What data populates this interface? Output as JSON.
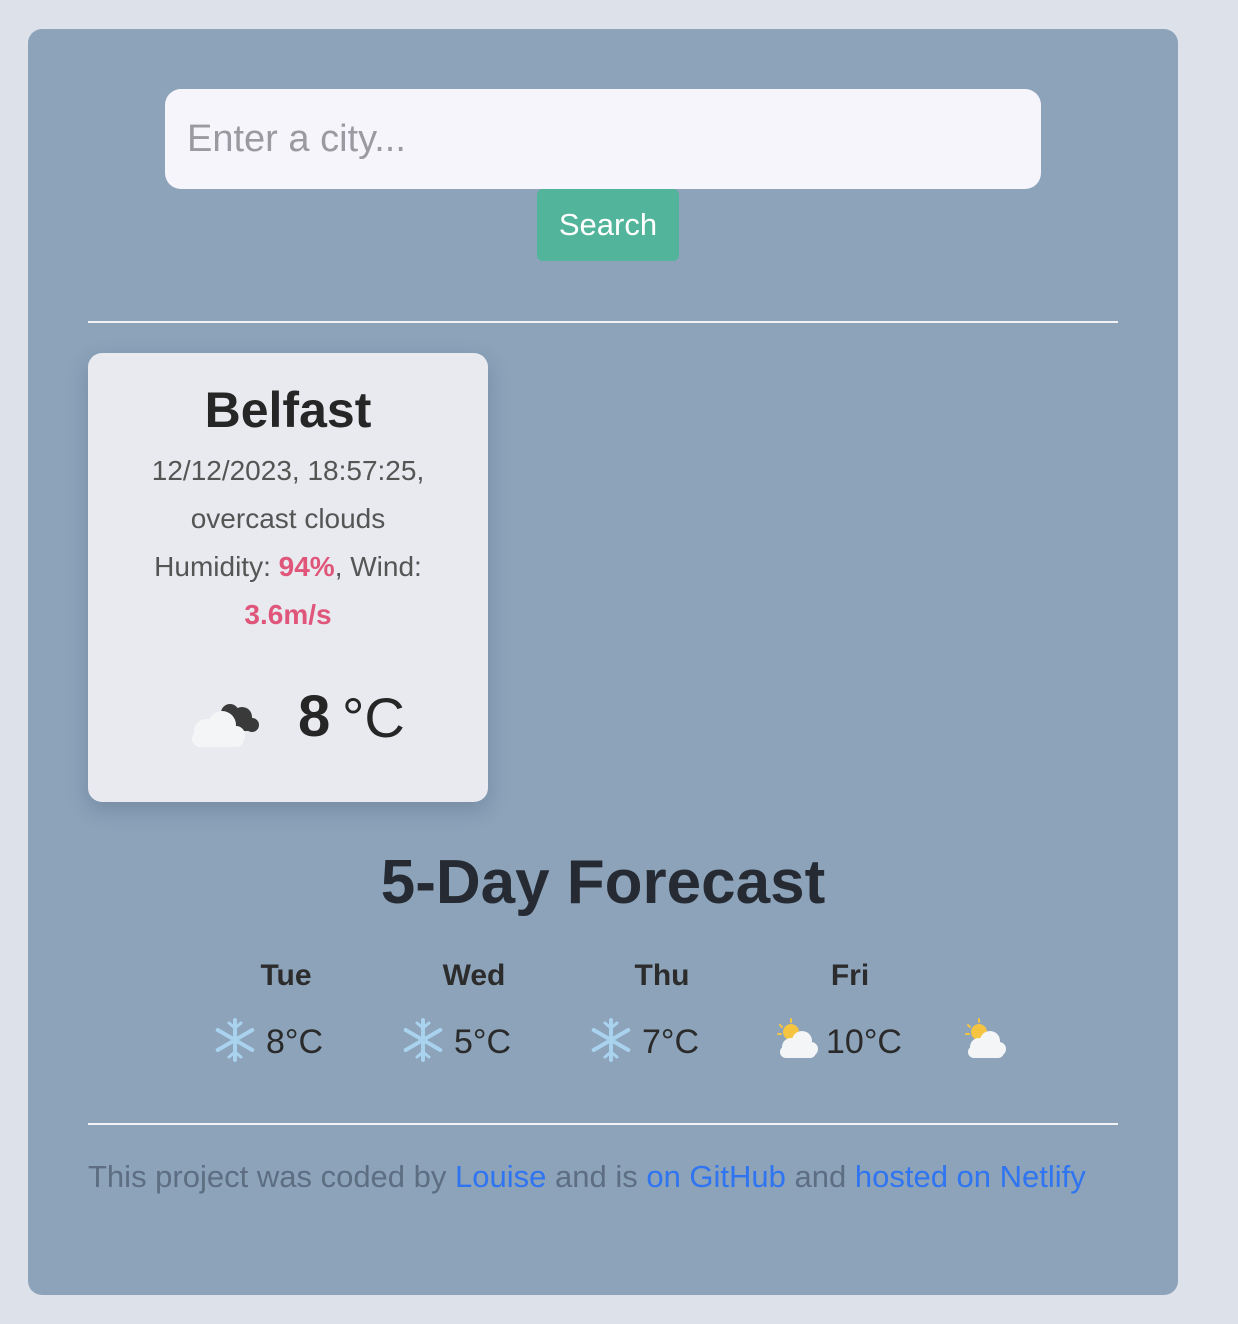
{
  "search": {
    "placeholder": "Enter a city...",
    "value": "",
    "button_label": "Search"
  },
  "current": {
    "city": "Belfast",
    "datetime": "12/12/2023, 18:57:25,",
    "description": "overcast clouds",
    "humidity_label": "Humidity: ",
    "humidity_value": "94%",
    "wind_label": ", Wind:",
    "wind_value": "3.6m/s",
    "icon": "overcast-cloud-icon",
    "temperature": "8",
    "unit": "°C"
  },
  "forecast": {
    "title": "5-Day Forecast",
    "days": [
      {
        "day": "Tue",
        "icon": "snowflake-icon",
        "temp": "8°C"
      },
      {
        "day": "Wed",
        "icon": "snowflake-icon",
        "temp": "5°C"
      },
      {
        "day": "Thu",
        "icon": "snowflake-icon",
        "temp": "7°C"
      },
      {
        "day": "Fri",
        "icon": "sun-behind-cloud-icon",
        "temp": "10°C"
      },
      {
        "day": "",
        "icon": "sun-behind-cloud-icon",
        "temp": ""
      }
    ]
  },
  "footer": {
    "text_1": "This project was coded by ",
    "author_link": "Louise",
    "text_2": " and is ",
    "github_link": "on GitHub",
    "text_3": " and ",
    "netlify_link": "hosted on Netlify"
  },
  "colors": {
    "panel": "#8ca3ba",
    "card": "#e8eaef",
    "button": "#52b49a",
    "highlight": "#e0557a",
    "link": "#2f74f0"
  }
}
